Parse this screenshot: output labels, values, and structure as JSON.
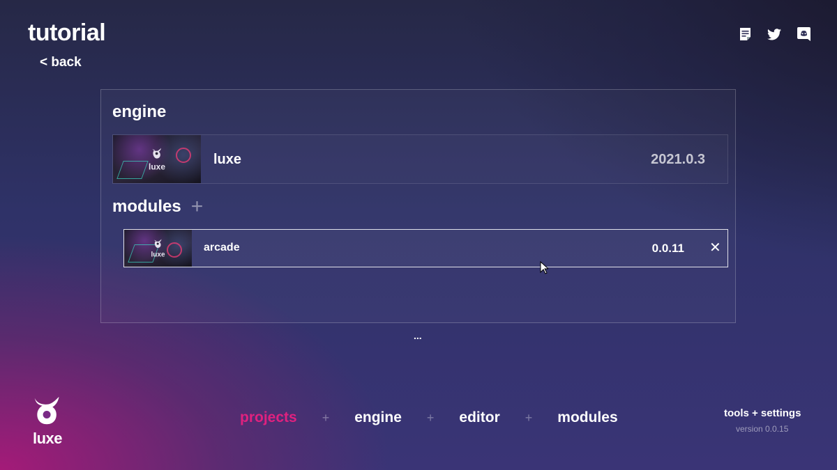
{
  "header": {
    "title": "tutorial",
    "back_label": "< back",
    "icons": [
      "notes-icon",
      "twitter-icon",
      "discord-icon"
    ]
  },
  "panel": {
    "engine_heading": "engine",
    "engine": {
      "name": "luxe",
      "version": "2021.0.3",
      "thumb_text": "luxe"
    },
    "modules_heading": "modules",
    "add_label": "+",
    "modules": [
      {
        "name": "arcade",
        "version": "0.0.11",
        "thumb_text": "luxe",
        "remove_label": "✕"
      }
    ]
  },
  "ellipsis": "...",
  "footer": {
    "brand_text": "luxe",
    "nav": [
      {
        "label": "projects",
        "active": true
      },
      {
        "label": "engine",
        "active": false
      },
      {
        "label": "editor",
        "active": false
      },
      {
        "label": "modules",
        "active": false
      }
    ],
    "separator": "+",
    "tools_label": "tools + settings",
    "version_label": "version 0.0.15"
  },
  "colors": {
    "accent": "#e0217f",
    "text": "#ffffff"
  }
}
